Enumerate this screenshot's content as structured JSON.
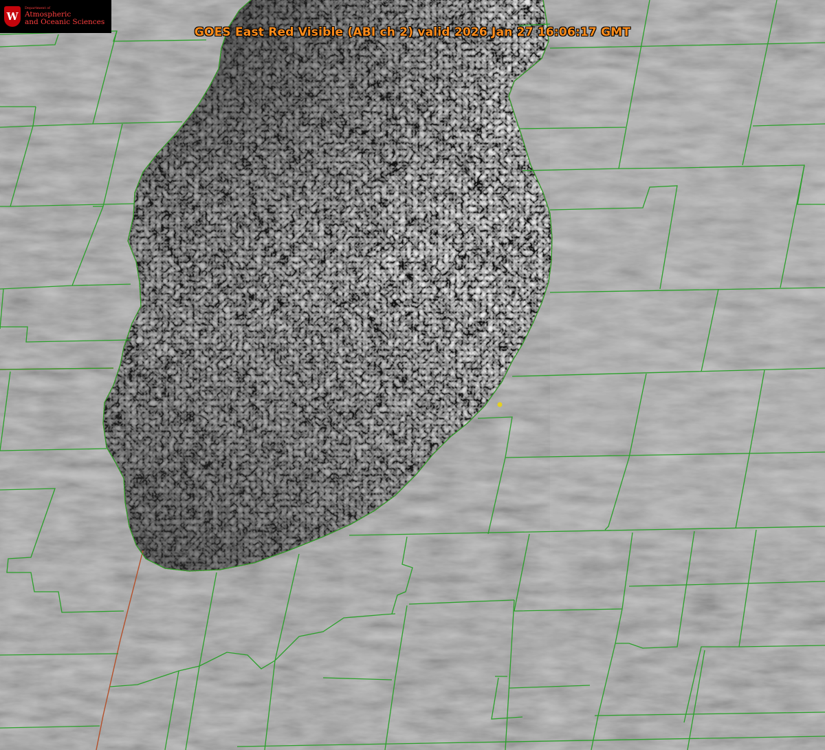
{
  "title": "GOES East Red Visible (ABI ch 2) valid 2026 Jan 27 16:06:17 GMT",
  "logo": {
    "icon": "w-crest-icon",
    "letter": "W",
    "department": "Department of",
    "line1": "Atmospheric",
    "line2": "and Oceanic Sciences"
  },
  "colors": {
    "title": "#ff8c1a",
    "county_lines": "#2aa02a",
    "state_line": "#d23a2a",
    "station_marker": "#e5d020",
    "lake": "#545454",
    "land_cloud": "#9a9a9a"
  }
}
